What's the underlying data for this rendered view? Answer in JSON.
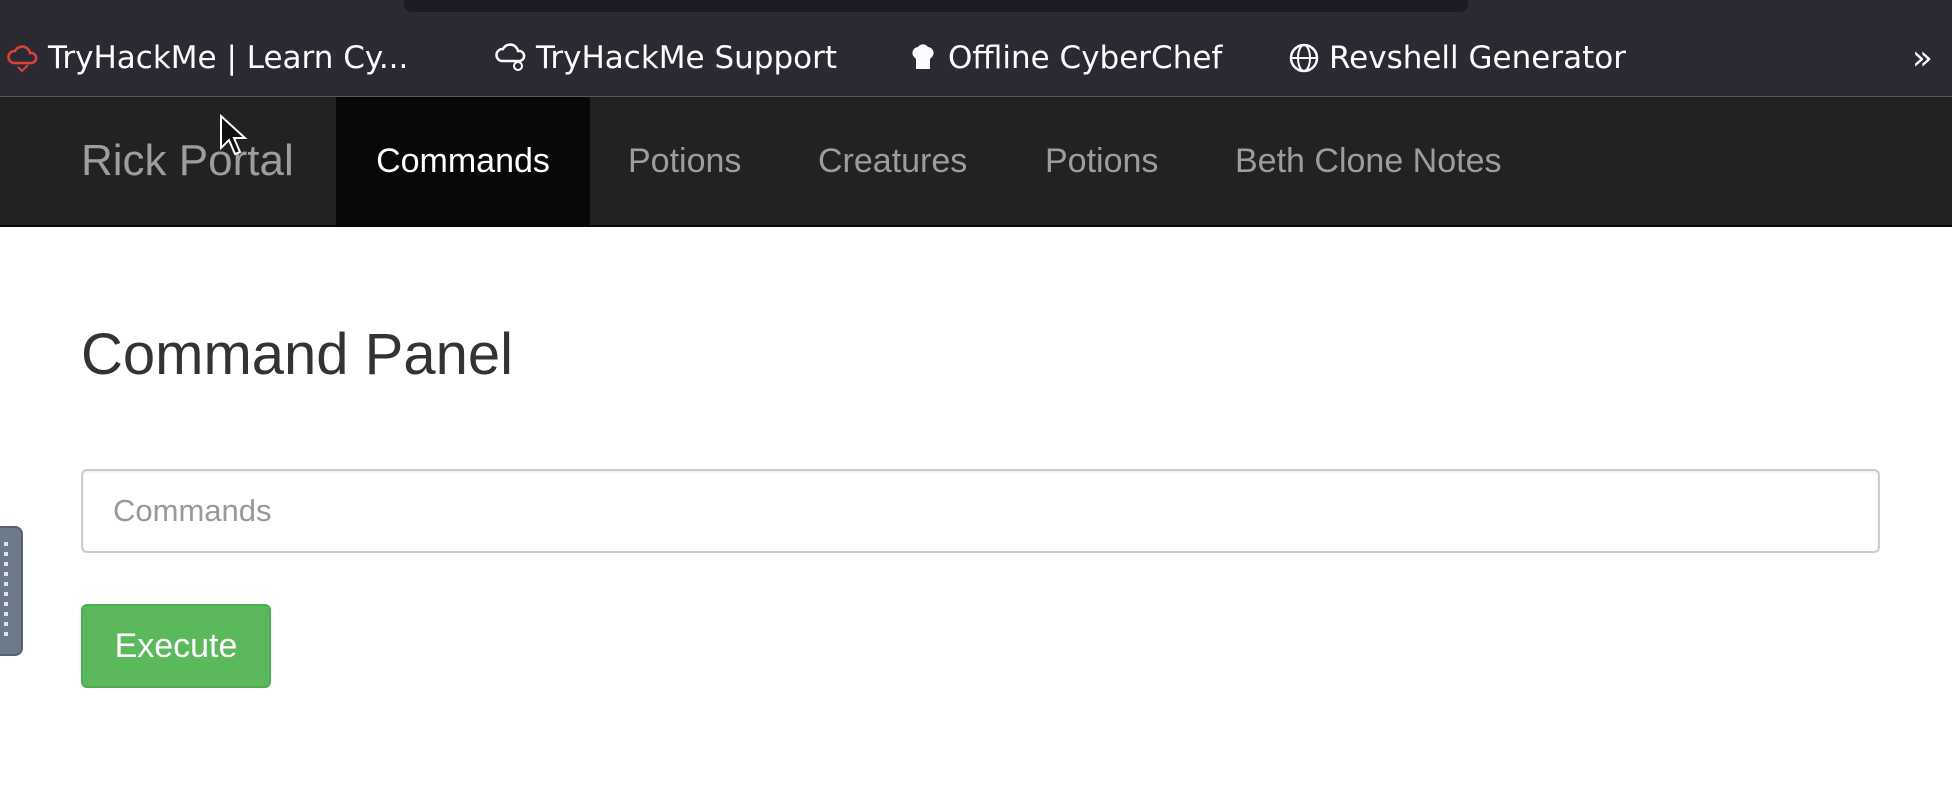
{
  "bookmarks": [
    {
      "label": "TryHackMe | Learn Cy...",
      "icon": "tryhackme-cloud-icon"
    },
    {
      "label": "TryHackMe Support",
      "icon": "cloud-support-icon"
    },
    {
      "label": "Offline CyberChef",
      "icon": "chef-hat-icon"
    },
    {
      "label": "Revshell Generator",
      "icon": "globe-icon"
    }
  ],
  "bookmarks_overflow": "»",
  "navbar": {
    "brand": "Rick Portal",
    "items": [
      {
        "label": "Commands",
        "active": true
      },
      {
        "label": "Potions",
        "active": false
      },
      {
        "label": "Creatures",
        "active": false
      },
      {
        "label": "Potions",
        "active": false
      },
      {
        "label": "Beth Clone Notes",
        "active": false
      }
    ]
  },
  "main": {
    "title": "Command Panel",
    "command_input": {
      "value": "",
      "placeholder": "Commands"
    },
    "execute_label": "Execute"
  },
  "colors": {
    "navbar_bg": "#222222",
    "nav_active_bg": "#080808",
    "button_success": "#5cb85c",
    "bookmarks_bg": "#2b2a33"
  }
}
